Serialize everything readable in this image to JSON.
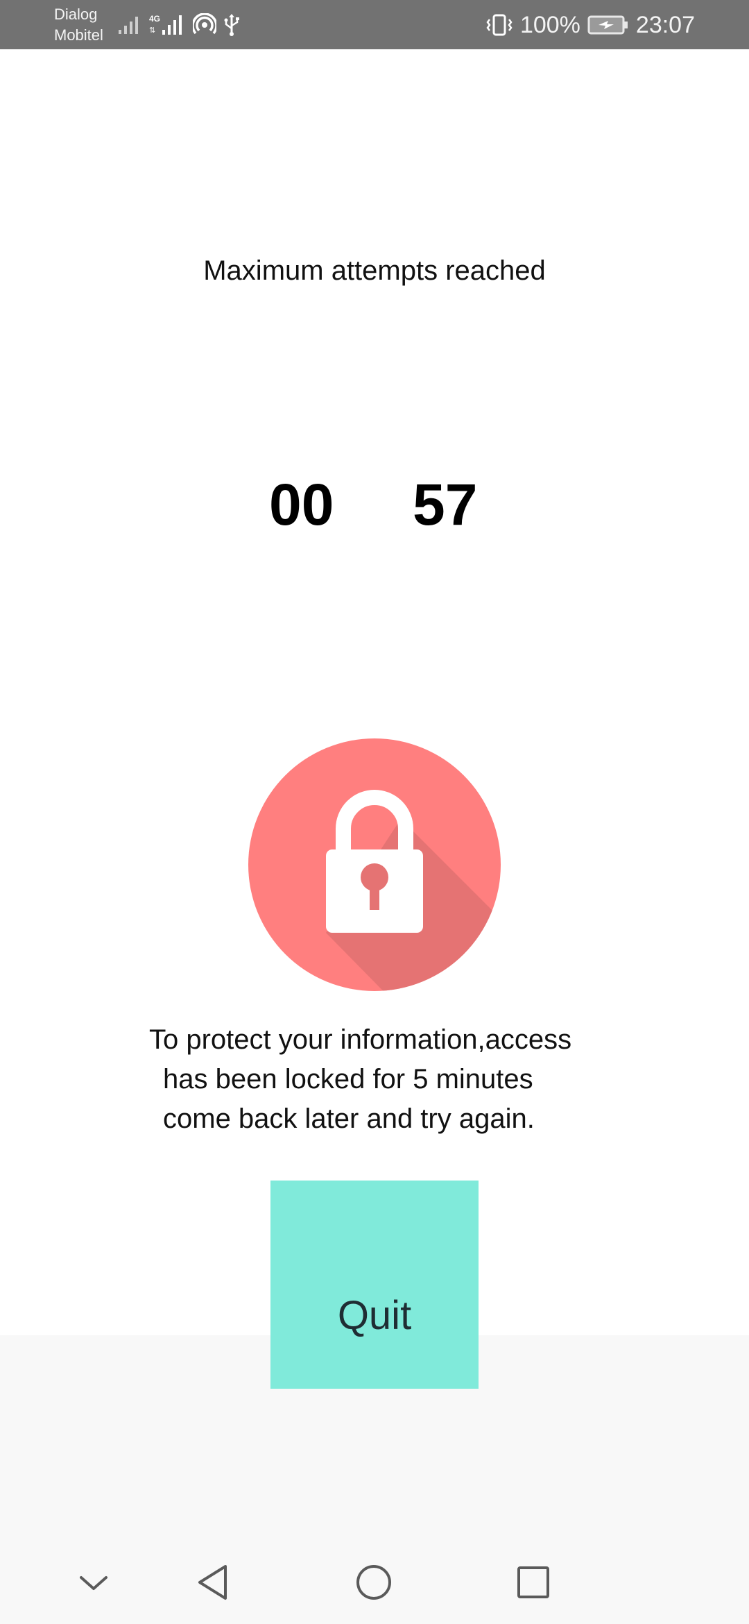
{
  "status_bar": {
    "carrier_line1": "Dialog",
    "carrier_line2": "Mobitel",
    "network_type": "4G",
    "battery_percent": "100%",
    "time": "23:07",
    "icons": [
      "signal-icon",
      "signal-4g-icon",
      "hotspot-icon",
      "usb-icon",
      "vibrate-icon",
      "battery-charging-icon"
    ]
  },
  "lockout": {
    "title": "Maximum attempts reached",
    "timer_minutes": "00",
    "timer_seconds": "57",
    "icon": "lock-icon",
    "message_lines": [
      "To protect your information,access",
      "has been locked for 5 minutes",
      "come back later and try again."
    ],
    "quit_label": "Quit"
  },
  "colors": {
    "status_bar_bg": "#727272",
    "lock_circle": "#ff7f7f",
    "lock_shadow": "#e57373",
    "quit_button_bg": "#80eada",
    "bottom_area_bg": "#f8f8f8"
  },
  "nav_bar": {
    "buttons": [
      "chevron-down-icon",
      "back-icon",
      "home-icon",
      "recents-icon"
    ]
  }
}
